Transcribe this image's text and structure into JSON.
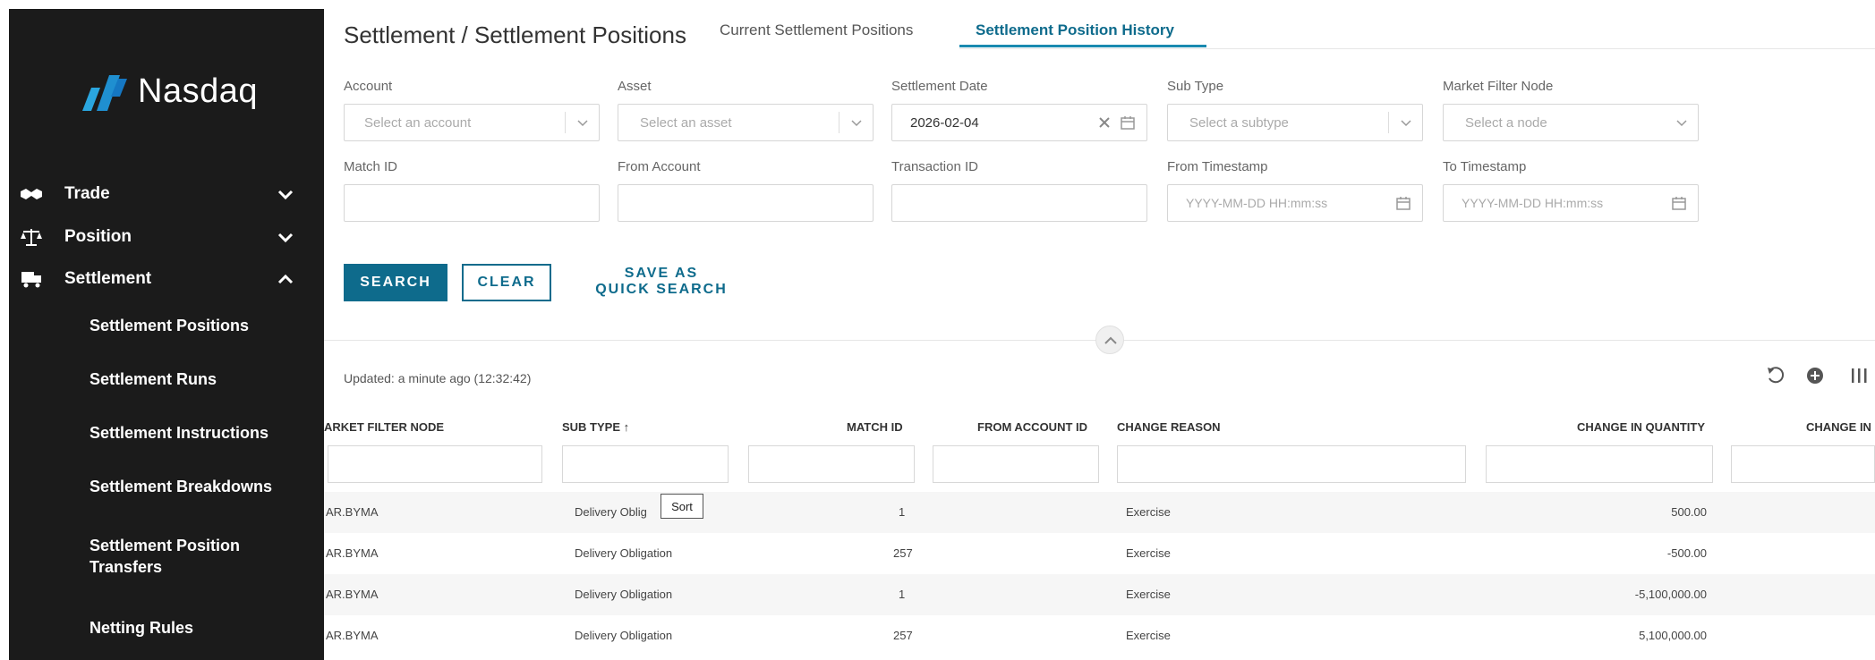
{
  "app": {
    "brand": "Nasdaq"
  },
  "sidebar": {
    "items": [
      {
        "label": "Trade",
        "icon": "handshake-icon",
        "expanded": false
      },
      {
        "label": "Position",
        "icon": "scale-icon",
        "expanded": false
      },
      {
        "label": "Settlement",
        "icon": "truck-icon",
        "expanded": true
      }
    ],
    "sub_items": [
      "Settlement Positions",
      "Settlement Runs",
      "Settlement Instructions",
      "Settlement Breakdowns",
      "Settlement Position Transfers",
      "Netting Rules"
    ]
  },
  "header": {
    "breadcrumb": "Settlement / Settlement Positions",
    "tabs": [
      {
        "label": "Current Settlement Positions",
        "active": false
      },
      {
        "label": "Settlement Position History",
        "active": true
      }
    ]
  },
  "filters": {
    "account": {
      "label": "Account",
      "placeholder": "Select an account"
    },
    "asset": {
      "label": "Asset",
      "placeholder": "Select an asset"
    },
    "settlement_date": {
      "label": "Settlement Date",
      "value": "2026-02-04"
    },
    "sub_type": {
      "label": "Sub Type",
      "placeholder": "Select a subtype"
    },
    "market_filter_node": {
      "label": "Market Filter Node",
      "placeholder": "Select a node"
    },
    "match_id": {
      "label": "Match ID",
      "value": ""
    },
    "from_account": {
      "label": "From Account",
      "value": ""
    },
    "transaction_id": {
      "label": "Transaction ID",
      "value": ""
    },
    "from_timestamp": {
      "label": "From Timestamp",
      "placeholder": "YYYY-MM-DD HH:mm:ss"
    },
    "to_timestamp": {
      "label": "To Timestamp",
      "placeholder": "YYYY-MM-DD HH:mm:ss"
    }
  },
  "actions": {
    "search": "SEARCH",
    "clear": "CLEAR",
    "save_line1": "SAVE AS",
    "save_line2": "QUICK SEARCH"
  },
  "table": {
    "updated": "Updated: a minute ago (12:32:42)",
    "columns": {
      "market_filter_node": "ARKET FILTER NODE",
      "sub_type": "SUB TYPE ↑",
      "match_id": "MATCH ID",
      "from_account_id": "FROM ACCOUNT ID",
      "change_reason": "CHANGE REASON",
      "change_in_quantity": "CHANGE IN QUANTITY",
      "change_in": "CHANGE IN"
    },
    "rows": [
      {
        "node": "AR.BYMA",
        "sub_type": "Delivery Oblig",
        "match_id": "1",
        "reason": "Exercise",
        "qty": "500.00"
      },
      {
        "node": "AR.BYMA",
        "sub_type": "Delivery Obligation",
        "match_id": "257",
        "reason": "Exercise",
        "qty": "-500.00"
      },
      {
        "node": "AR.BYMA",
        "sub_type": "Delivery Obligation",
        "match_id": "1",
        "reason": "Exercise",
        "qty": "-5,100,000.00"
      },
      {
        "node": "AR.BYMA",
        "sub_type": "Delivery Obligation",
        "match_id": "257",
        "reason": "Exercise",
        "qty": "5,100,000.00"
      }
    ],
    "tooltip": "Sort"
  },
  "colors": {
    "accent": "#0e6b8c",
    "sidebar_bg": "#1b1b1b",
    "tab_active": "#1a8ab0",
    "logo_blue": "#2aa6df"
  }
}
